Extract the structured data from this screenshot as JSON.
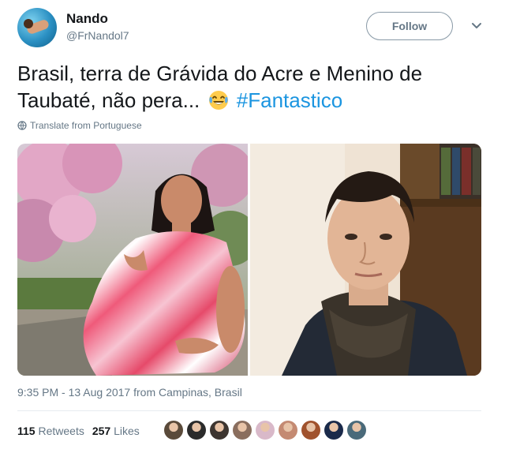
{
  "user": {
    "name": "Nando",
    "handle": "@FrNandol7"
  },
  "follow_label": "Follow",
  "tweet": {
    "text_main": "Brasil, terra de Grávida do Acre e Menino de Taubaté, não pera...",
    "emoji": "face-with-tears-of-joy",
    "hashtag": "#Fantastico"
  },
  "translate_label": "Translate from Portuguese",
  "timestamp": "9:35 PM - 13 Aug 2017 from Campinas, Brasil",
  "stats": {
    "retweets_count": "115",
    "retweets_label": "Retweets",
    "likes_count": "257",
    "likes_label": "Likes"
  },
  "colors": {
    "link": "#1b95e0",
    "secondary_text": "#657786",
    "divider": "#e6ecf0"
  },
  "likers": [
    {
      "name": "avatar-1",
      "color": "#5a4a3a"
    },
    {
      "name": "avatar-2",
      "color": "#2b2b2b"
    },
    {
      "name": "avatar-3",
      "color": "#3d3530"
    },
    {
      "name": "avatar-4",
      "color": "#8a6e5e"
    },
    {
      "name": "avatar-5",
      "color": "#d9b9c9"
    },
    {
      "name": "avatar-6",
      "color": "#c48a72"
    },
    {
      "name": "avatar-7",
      "color": "#a0522d"
    },
    {
      "name": "avatar-8",
      "color": "#1a2a4a"
    },
    {
      "name": "avatar-9",
      "color": "#4a6a7a"
    }
  ]
}
